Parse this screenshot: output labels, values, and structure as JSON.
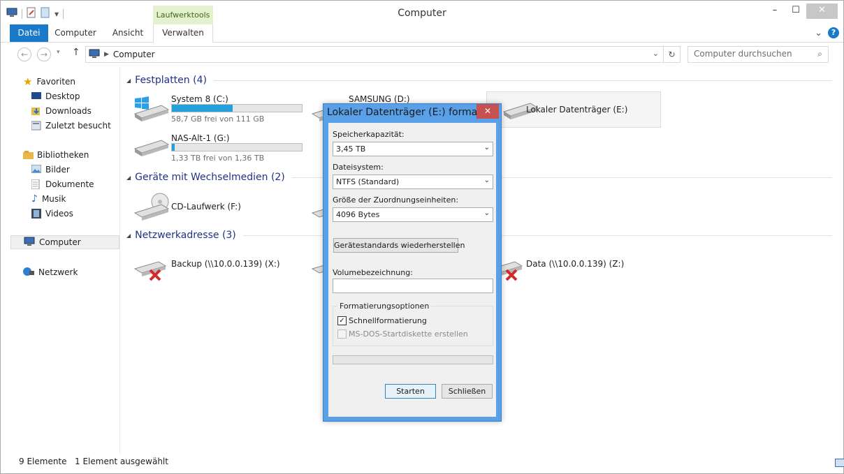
{
  "window": {
    "title": "Computer",
    "context_tab_header": "Laufwerktools",
    "controls": {
      "minimize": "–",
      "maximize": "☐",
      "close": "✕"
    }
  },
  "ribbon": {
    "tabs": [
      "Datei",
      "Computer",
      "Ansicht",
      "Verwalten"
    ],
    "collapse_glyph": "⌄",
    "help_glyph": "?"
  },
  "address": {
    "path": "Computer",
    "search_placeholder": "Computer durchsuchen"
  },
  "nav": {
    "favorites_label": "Favoriten",
    "favorites": [
      "Desktop",
      "Downloads",
      "Zuletzt besucht"
    ],
    "libraries_label": "Bibliotheken",
    "libraries": [
      "Bilder",
      "Dokumente",
      "Musik",
      "Videos"
    ],
    "computer_label": "Computer",
    "network_label": "Netzwerk"
  },
  "groups": {
    "hard_drives": "Festplatten (4)",
    "removable": "Geräte mit Wechselmedien (2)",
    "network": "Netzwerkadresse (3)"
  },
  "drives": {
    "c": {
      "name": "System 8 (C:)",
      "free": "58,7 GB frei von 111 GB",
      "used_fraction": 0.47
    },
    "d": {
      "name": "SAMSUNG (D:)"
    },
    "e": {
      "name": "Lokaler Datenträger (E:)"
    },
    "g": {
      "name": "NAS-Alt-1 (G:)",
      "free": "1,33 TB frei von 1,36 TB",
      "used_fraction": 0.02
    },
    "f": {
      "name": "CD-Laufwerk (F:)"
    },
    "x": {
      "name": "Backup (\\\\10.0.0.139) (X:)"
    },
    "z": {
      "name": "Data (\\\\10.0.0.139) (Z:)"
    }
  },
  "status": {
    "count": "9 Elemente",
    "selected": "1 Element ausgewählt"
  },
  "dialog": {
    "title": "Lokaler Datenträger (E:) formati...",
    "capacity_label": "Speicherkapazität:",
    "capacity_value": "3,45 TB",
    "filesystem_label": "Dateisystem:",
    "filesystem_value": "NTFS (Standard)",
    "alloc_label": "Größe der Zuordnungseinheiten:",
    "alloc_value": "4096 Bytes",
    "restore_button": "Gerätestandards wiederherstellen",
    "volume_label": "Volumebezeichnung:",
    "volume_value": "",
    "options_label": "Formatierungsoptionen",
    "quick_format": "Schnellformatierung",
    "quick_format_checked": true,
    "msdos": "MS-DOS-Startdiskette erstellen",
    "progress": 0,
    "start_button": "Starten",
    "close_button": "Schließen"
  },
  "colors": {
    "accent": "#1979ca",
    "group_title": "#1e3287",
    "progress_fill": "#26a0da"
  }
}
